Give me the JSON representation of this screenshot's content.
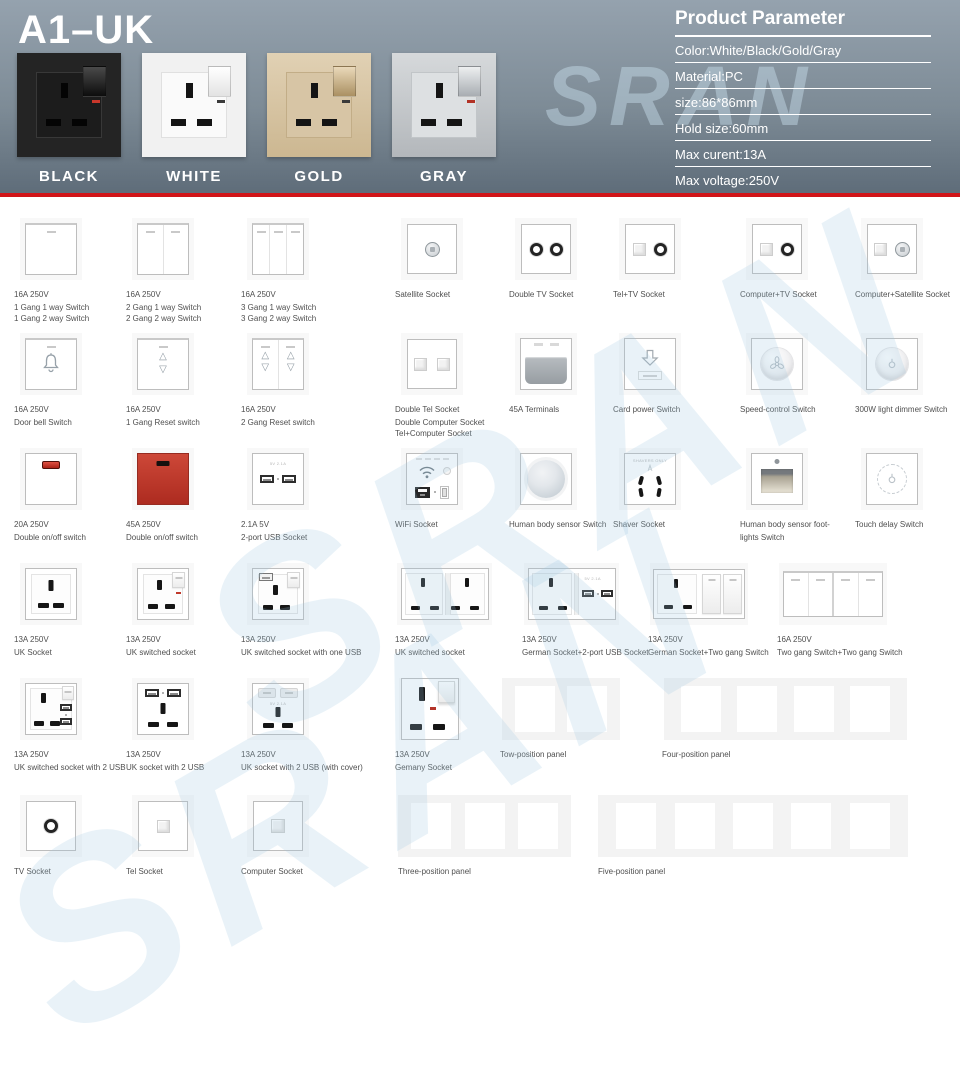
{
  "watermark": "SRAN",
  "header": {
    "title": "A1–UK",
    "variants": [
      {
        "label": "BLACK"
      },
      {
        "label": "WHITE"
      },
      {
        "label": "GOLD"
      },
      {
        "label": "GRAY"
      }
    ],
    "parameter": {
      "title": "Product Parameter",
      "rows": [
        "Color:White/Black/Gold/Gray",
        "Material:PC",
        "size:86*86mm",
        "Hold size:60mm",
        "Max curent:13A",
        "Max voltage:250V"
      ]
    }
  },
  "colors": {
    "accent_red": "#d01418",
    "header_gradient_top": "#95a2ae",
    "header_gradient_bottom": "#5d6b78",
    "watermark_blue": "#9fc9e2",
    "variant_black": "#242424",
    "variant_white": "#f1f1f1",
    "variant_gold": "#d8c6a9",
    "variant_gray": "#c5c9cc",
    "red_switch_plate": "#bf372b",
    "label_text": "#4f4f4f"
  },
  "grid": {
    "rows": [
      {
        "items": [
          {
            "icon": "switch-1",
            "lines": [
              "16A 250V",
              "1 Gang 1 way Switch",
              "1 Gang 2 way Switch"
            ]
          },
          {
            "icon": "switch-2",
            "lines": [
              "16A 250V",
              "2 Gang 1 way Switch",
              "2 Gang 2 way Switch"
            ]
          },
          {
            "icon": "switch-3",
            "lines": [
              "16A 250V",
              "3 Gang 1 way Switch",
              "3 Gang 2 way Switch"
            ]
          },
          {
            "icon": "satellite",
            "lines": [
              "Satellite Socket"
            ]
          },
          {
            "icon": "double-tv",
            "lines": [
              "Double TV Socket"
            ]
          },
          {
            "icon": "tel-tv",
            "lines": [
              "Tel+TV Socket"
            ]
          },
          {
            "icon": "computer-tv",
            "lines": [
              "Computer+TV Socket"
            ]
          },
          {
            "icon": "computer-satellite",
            "lines": [
              "Computer+Satellite Socket"
            ]
          }
        ]
      },
      {
        "items": [
          {
            "icon": "doorbell",
            "lines": [
              "16A 250V",
              "Door bell Switch"
            ]
          },
          {
            "icon": "reset-1",
            "lines": [
              "16A 250V",
              "1 Gang Reset switch"
            ]
          },
          {
            "icon": "reset-2",
            "lines": [
              "16A 250V",
              "2 Gang Reset switch"
            ]
          },
          {
            "icon": "double-tel",
            "lines": [
              "Double Tel Socket",
              "Double Computer Socket",
              "Tel+Computer Socket"
            ]
          },
          {
            "icon": "terminals",
            "lines": [
              "45A Terminals"
            ]
          },
          {
            "icon": "card-power",
            "lines": [
              "Card power Switch"
            ]
          },
          {
            "icon": "speed-control",
            "lines": [
              "Speed-control Switch"
            ]
          },
          {
            "icon": "dimmer",
            "lines": [
              "300W light dimmer Switch"
            ]
          }
        ]
      },
      {
        "items": [
          {
            "icon": "dos-white",
            "lines": [
              "20A 250V",
              "Double on/off switch"
            ]
          },
          {
            "icon": "dos-red",
            "lines": [
              "45A 250V",
              "Double on/off switch"
            ]
          },
          {
            "icon": "usb-2",
            "lines": [
              "2.1A 5V",
              "2-port USB Socket"
            ]
          },
          {
            "icon": "wifi",
            "lines": [
              "WiFi Socket"
            ]
          },
          {
            "icon": "body-sensor",
            "lines": [
              "Human body sensor Switch"
            ]
          },
          {
            "icon": "shaver",
            "lines": [
              "Shaver Socket"
            ]
          },
          {
            "icon": "foot-lights",
            "lines": [
              "Human body sensor foot-",
              "lights Switch"
            ]
          },
          {
            "icon": "touch-delay",
            "lines": [
              "Touch delay Switch"
            ]
          }
        ]
      },
      {
        "items": [
          {
            "icon": "uk-socket",
            "lines": [
              "13A 250V",
              "UK Socket"
            ]
          },
          {
            "icon": "uk-switched",
            "lines": [
              "13A 250V",
              "UK switched socket"
            ]
          },
          {
            "icon": "uk-switched-1usb",
            "lines": [
              "13A 250V",
              "UK switched socket with one USB"
            ]
          },
          {
            "icon": "uk-double",
            "lines": [
              "13A 250V",
              "UK switched socket"
            ]
          },
          {
            "icon": "german-usb",
            "lines": [
              "13A 250V",
              "German Socket+2-port USB Socket"
            ]
          },
          {
            "icon": "german-2switch",
            "lines": [
              "13A 250V",
              "German Socket+Two gang Switch"
            ]
          },
          {
            "icon": "switch-4",
            "lines": [
              "16A 250V",
              "Two gang Switch+Two gang Switch"
            ]
          }
        ]
      },
      {
        "items": [
          {
            "icon": "uk-switched-2usb",
            "lines": [
              "13A 250V",
              "UK switched socket with 2 USB"
            ]
          },
          {
            "icon": "uk-2usb",
            "lines": [
              "13A 250V",
              "UK socket with 2 USB"
            ]
          },
          {
            "icon": "uk-2usb-cover",
            "lines": [
              "13A 250V",
              "UK socket with 2 USB (with cover)"
            ]
          },
          {
            "icon": "gemany",
            "lines": [
              "13A 250V",
              "Gemany Socket"
            ]
          },
          {
            "icon": "panel-2",
            "lines": [
              "Tow-position panel"
            ]
          },
          {
            "icon": "panel-4",
            "lines": [
              "Four-position panel"
            ]
          }
        ]
      },
      {
        "items": [
          {
            "icon": "tv",
            "lines": [
              "TV Socket"
            ]
          },
          {
            "icon": "tel",
            "lines": [
              "Tel Socket"
            ]
          },
          {
            "icon": "computer",
            "lines": [
              "Computer Socket"
            ]
          },
          {
            "icon": "panel-3",
            "lines": [
              "Three-position panel"
            ]
          },
          {
            "icon": "panel-5",
            "lines": [
              "Five-position panel"
            ]
          }
        ]
      }
    ]
  }
}
